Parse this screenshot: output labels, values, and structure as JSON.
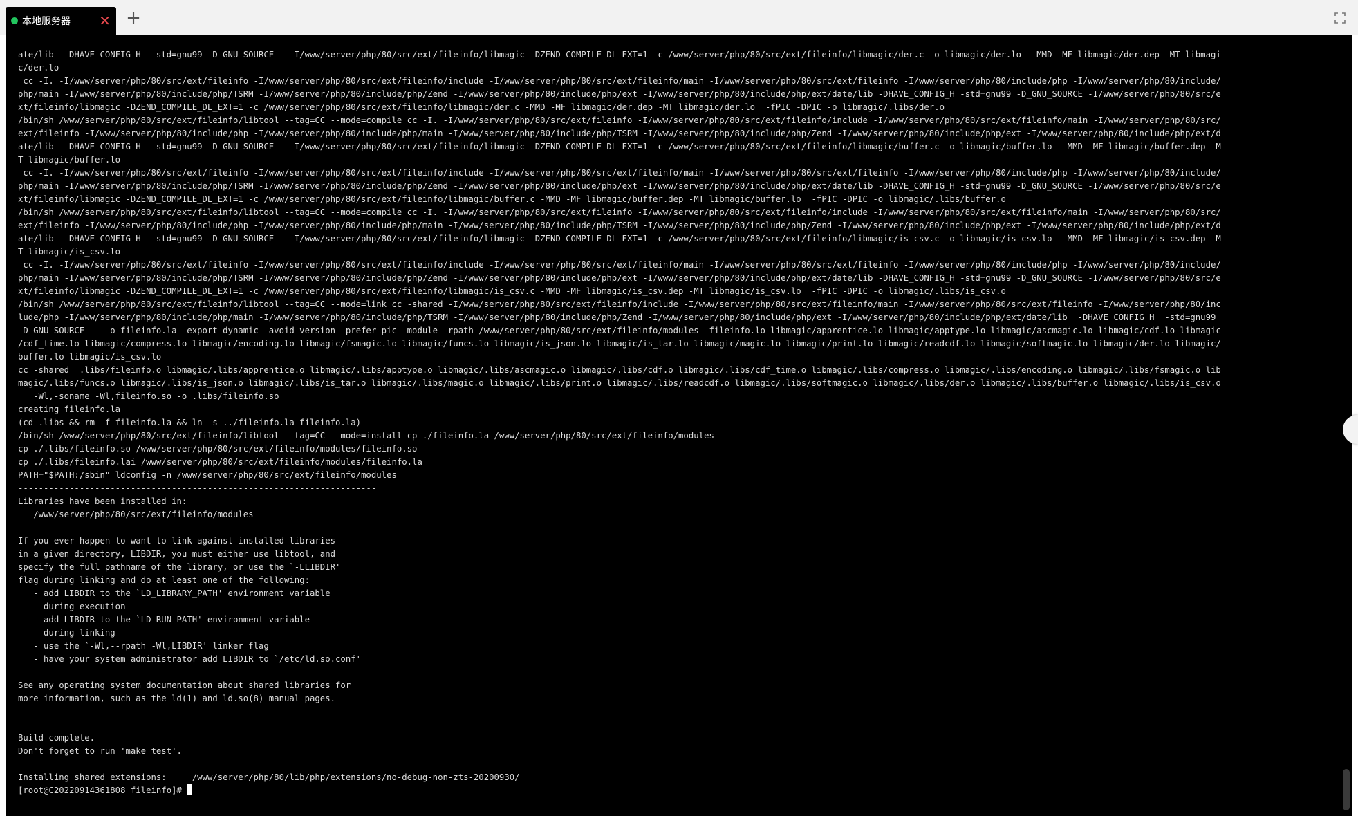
{
  "tab": {
    "label": "本地服务器",
    "status_color": "#22c55e",
    "close_symbol": "✕",
    "add_symbol": "+"
  },
  "toolbar": {
    "fullscreen_icon": "fullscreen-icon"
  },
  "terminal": {
    "lines": [
      "ate/lib  -DHAVE_CONFIG_H  -std=gnu99 -D_GNU_SOURCE   -I/www/server/php/80/src/ext/fileinfo/libmagic -DZEND_COMPILE_DL_EXT=1 -c /www/server/php/80/src/ext/fileinfo/libmagic/der.c -o libmagic/der.lo  -MMD -MF libmagic/der.dep -MT libmagi",
      "c/der.lo",
      " cc -I. -I/www/server/php/80/src/ext/fileinfo -I/www/server/php/80/src/ext/fileinfo/include -I/www/server/php/80/src/ext/fileinfo/main -I/www/server/php/80/src/ext/fileinfo -I/www/server/php/80/include/php -I/www/server/php/80/include/",
      "php/main -I/www/server/php/80/include/php/TSRM -I/www/server/php/80/include/php/Zend -I/www/server/php/80/include/php/ext -I/www/server/php/80/include/php/ext/date/lib -DHAVE_CONFIG_H -std=gnu99 -D_GNU_SOURCE -I/www/server/php/80/src/e",
      "xt/fileinfo/libmagic -DZEND_COMPILE_DL_EXT=1 -c /www/server/php/80/src/ext/fileinfo/libmagic/der.c -MMD -MF libmagic/der.dep -MT libmagic/der.lo  -fPIC -DPIC -o libmagic/.libs/der.o",
      "/bin/sh /www/server/php/80/src/ext/fileinfo/libtool --tag=CC --mode=compile cc -I. -I/www/server/php/80/src/ext/fileinfo -I/www/server/php/80/src/ext/fileinfo/include -I/www/server/php/80/src/ext/fileinfo/main -I/www/server/php/80/src/",
      "ext/fileinfo -I/www/server/php/80/include/php -I/www/server/php/80/include/php/main -I/www/server/php/80/include/php/TSRM -I/www/server/php/80/include/php/Zend -I/www/server/php/80/include/php/ext -I/www/server/php/80/include/php/ext/d",
      "ate/lib  -DHAVE_CONFIG_H  -std=gnu99 -D_GNU_SOURCE   -I/www/server/php/80/src/ext/fileinfo/libmagic -DZEND_COMPILE_DL_EXT=1 -c /www/server/php/80/src/ext/fileinfo/libmagic/buffer.c -o libmagic/buffer.lo  -MMD -MF libmagic/buffer.dep -M",
      "T libmagic/buffer.lo",
      " cc -I. -I/www/server/php/80/src/ext/fileinfo -I/www/server/php/80/src/ext/fileinfo/include -I/www/server/php/80/src/ext/fileinfo/main -I/www/server/php/80/src/ext/fileinfo -I/www/server/php/80/include/php -I/www/server/php/80/include/",
      "php/main -I/www/server/php/80/include/php/TSRM -I/www/server/php/80/include/php/Zend -I/www/server/php/80/include/php/ext -I/www/server/php/80/include/php/ext/date/lib -DHAVE_CONFIG_H -std=gnu99 -D_GNU_SOURCE -I/www/server/php/80/src/e",
      "xt/fileinfo/libmagic -DZEND_COMPILE_DL_EXT=1 -c /www/server/php/80/src/ext/fileinfo/libmagic/buffer.c -MMD -MF libmagic/buffer.dep -MT libmagic/buffer.lo  -fPIC -DPIC -o libmagic/.libs/buffer.o",
      "/bin/sh /www/server/php/80/src/ext/fileinfo/libtool --tag=CC --mode=compile cc -I. -I/www/server/php/80/src/ext/fileinfo -I/www/server/php/80/src/ext/fileinfo/include -I/www/server/php/80/src/ext/fileinfo/main -I/www/server/php/80/src/",
      "ext/fileinfo -I/www/server/php/80/include/php -I/www/server/php/80/include/php/main -I/www/server/php/80/include/php/TSRM -I/www/server/php/80/include/php/Zend -I/www/server/php/80/include/php/ext -I/www/server/php/80/include/php/ext/d",
      "ate/lib  -DHAVE_CONFIG_H  -std=gnu99 -D_GNU_SOURCE   -I/www/server/php/80/src/ext/fileinfo/libmagic -DZEND_COMPILE_DL_EXT=1 -c /www/server/php/80/src/ext/fileinfo/libmagic/is_csv.c -o libmagic/is_csv.lo  -MMD -MF libmagic/is_csv.dep -M",
      "T libmagic/is_csv.lo",
      " cc -I. -I/www/server/php/80/src/ext/fileinfo -I/www/server/php/80/src/ext/fileinfo/include -I/www/server/php/80/src/ext/fileinfo/main -I/www/server/php/80/src/ext/fileinfo -I/www/server/php/80/include/php -I/www/server/php/80/include/",
      "php/main -I/www/server/php/80/include/php/TSRM -I/www/server/php/80/include/php/Zend -I/www/server/php/80/include/php/ext -I/www/server/php/80/include/php/ext/date/lib -DHAVE_CONFIG_H -std=gnu99 -D_GNU_SOURCE -I/www/server/php/80/src/e",
      "xt/fileinfo/libmagic -DZEND_COMPILE_DL_EXT=1 -c /www/server/php/80/src/ext/fileinfo/libmagic/is_csv.c -MMD -MF libmagic/is_csv.dep -MT libmagic/is_csv.lo  -fPIC -DPIC -o libmagic/.libs/is_csv.o",
      "/bin/sh /www/server/php/80/src/ext/fileinfo/libtool --tag=CC --mode=link cc -shared -I/www/server/php/80/src/ext/fileinfo/include -I/www/server/php/80/src/ext/fileinfo/main -I/www/server/php/80/src/ext/fileinfo -I/www/server/php/80/inc",
      "lude/php -I/www/server/php/80/include/php/main -I/www/server/php/80/include/php/TSRM -I/www/server/php/80/include/php/Zend -I/www/server/php/80/include/php/ext -I/www/server/php/80/include/php/ext/date/lib  -DHAVE_CONFIG_H  -std=gnu99",
      "-D_GNU_SOURCE    -o fileinfo.la -export-dynamic -avoid-version -prefer-pic -module -rpath /www/server/php/80/src/ext/fileinfo/modules  fileinfo.lo libmagic/apprentice.lo libmagic/apptype.lo libmagic/ascmagic.lo libmagic/cdf.lo libmagic",
      "/cdf_time.lo libmagic/compress.lo libmagic/encoding.lo libmagic/fsmagic.lo libmagic/funcs.lo libmagic/is_json.lo libmagic/is_tar.lo libmagic/magic.lo libmagic/print.lo libmagic/readcdf.lo libmagic/softmagic.lo libmagic/der.lo libmagic/",
      "buffer.lo libmagic/is_csv.lo",
      "cc -shared  .libs/fileinfo.o libmagic/.libs/apprentice.o libmagic/.libs/apptype.o libmagic/.libs/ascmagic.o libmagic/.libs/cdf.o libmagic/.libs/cdf_time.o libmagic/.libs/compress.o libmagic/.libs/encoding.o libmagic/.libs/fsmagic.o lib",
      "magic/.libs/funcs.o libmagic/.libs/is_json.o libmagic/.libs/is_tar.o libmagic/.libs/magic.o libmagic/.libs/print.o libmagic/.libs/readcdf.o libmagic/.libs/softmagic.o libmagic/.libs/der.o libmagic/.libs/buffer.o libmagic/.libs/is_csv.o",
      "   -Wl,-soname -Wl,fileinfo.so -o .libs/fileinfo.so",
      "creating fileinfo.la",
      "(cd .libs && rm -f fileinfo.la && ln -s ../fileinfo.la fileinfo.la)",
      "/bin/sh /www/server/php/80/src/ext/fileinfo/libtool --tag=CC --mode=install cp ./fileinfo.la /www/server/php/80/src/ext/fileinfo/modules",
      "cp ./.libs/fileinfo.so /www/server/php/80/src/ext/fileinfo/modules/fileinfo.so",
      "cp ./.libs/fileinfo.lai /www/server/php/80/src/ext/fileinfo/modules/fileinfo.la",
      "PATH=\"$PATH:/sbin\" ldconfig -n /www/server/php/80/src/ext/fileinfo/modules",
      "----------------------------------------------------------------------",
      "Libraries have been installed in:",
      "   /www/server/php/80/src/ext/fileinfo/modules",
      "",
      "If you ever happen to want to link against installed libraries",
      "in a given directory, LIBDIR, you must either use libtool, and",
      "specify the full pathname of the library, or use the `-LLIBDIR'",
      "flag during linking and do at least one of the following:",
      "   - add LIBDIR to the `LD_LIBRARY_PATH' environment variable",
      "     during execution",
      "   - add LIBDIR to the `LD_RUN_PATH' environment variable",
      "     during linking",
      "   - use the `-Wl,--rpath -Wl,LIBDIR' linker flag",
      "   - have your system administrator add LIBDIR to `/etc/ld.so.conf'",
      "",
      "See any operating system documentation about shared libraries for",
      "more information, such as the ld(1) and ld.so(8) manual pages.",
      "----------------------------------------------------------------------",
      "",
      "Build complete.",
      "Don't forget to run 'make test'.",
      "",
      "Installing shared extensions:     /www/server/php/80/lib/php/extensions/no-debug-non-zts-20200930/"
    ],
    "prompt": "[root@C20220914361808 fileinfo]# "
  }
}
